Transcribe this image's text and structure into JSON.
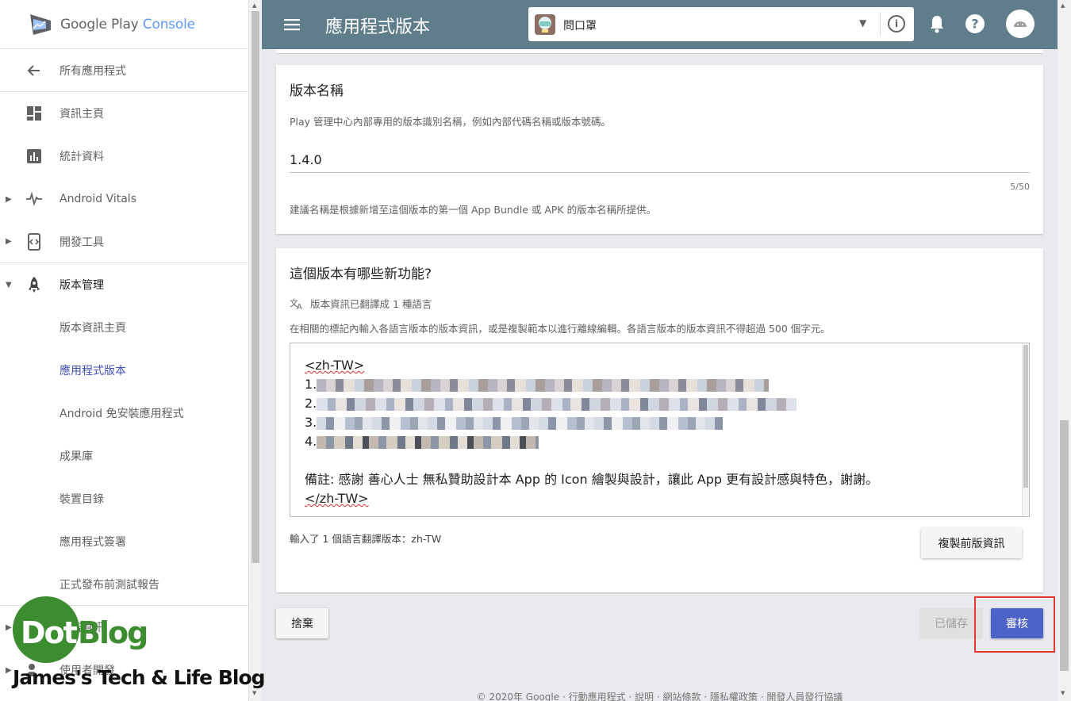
{
  "sidebar": {
    "logo_text_a": "Google Play",
    "logo_text_b": "Console",
    "items": [
      {
        "label": "所有應用程式",
        "icon": "arrow-back-icon"
      },
      {
        "label": "資訊主頁",
        "icon": "dashboard-icon"
      },
      {
        "label": "統計資料",
        "icon": "bar-chart-icon"
      },
      {
        "label": "Android Vitals",
        "icon": "vitals-pulse-icon"
      },
      {
        "label": "開發工具",
        "icon": "dev-tools-icon"
      },
      {
        "label": "版本管理",
        "icon": "rocket-icon"
      },
      {
        "label": "版本資訊主頁"
      },
      {
        "label": "應用程式版本"
      },
      {
        "label": "Android 免安裝應用程式"
      },
      {
        "label": "成果庫"
      },
      {
        "label": "裝置目錄"
      },
      {
        "label": "應用程式簽署"
      },
      {
        "label": "正式發布前測試報告"
      },
      {
        "label": "商店資訊",
        "icon": "store-icon"
      },
      {
        "label": "使用者開發",
        "icon": "users-icon"
      }
    ]
  },
  "topbar": {
    "title": "應用程式版本",
    "app_name": "問口罩"
  },
  "version_card": {
    "heading": "版本名稱",
    "hint": "Play 管理中心內部專用的版本識別名稱，例如內部代碼名稱或版本號碼。",
    "value": "1.4.0",
    "counter": "5/50",
    "note": "建議名稱是根據新增至這個版本的第一個 App Bundle 或 APK 的版本名稱所提供。"
  },
  "notes_card": {
    "heading": "這個版本有哪些新功能?",
    "translated": "版本資訊已翻譯成 1 種語言",
    "hint": "在相關的標記內輸入各語言版本的版本資訊，或是複製範本以進行離線編輯。各語言版本的版本資訊不得超過 500 個字元。",
    "open_tag": "<zh-TW>",
    "line_numbers": [
      "1.",
      "2.",
      "3.",
      "4."
    ],
    "remark": "備註: 感謝 善心人士 無私贊助設計本 App 的 Icon 繪製與設計，讓此 App 更有設計感與特色，謝謝。",
    "close_tag": "</zh-TW>",
    "languages_entered": "輸入了 1 個語言翻譯版本：zh-TW",
    "copy_button": "複製前版資訊"
  },
  "actions": {
    "discard": "捨棄",
    "saved": "已儲存",
    "review": "審核"
  },
  "footer": "© 2020年 Google · 行動應用程式 · 說明 · 網站條款 · 隱私權政策 · 開發人員發行協議",
  "watermark": {
    "dot": "Dot",
    "blog": "Blog",
    "tagline": "James's Tech & Life Blog"
  },
  "colors": {
    "topbar": "#607d8b",
    "accent": "#3f51b5",
    "review_button": "#4e63c8",
    "highlight": "#e53935"
  }
}
